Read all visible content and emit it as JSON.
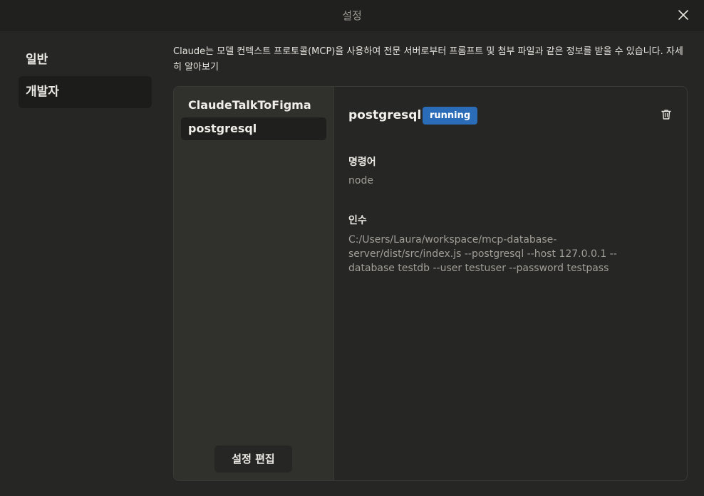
{
  "window": {
    "title": "설정"
  },
  "nav": {
    "items": [
      {
        "label": "일반"
      },
      {
        "label": "개발자"
      }
    ]
  },
  "developer": {
    "description": "Claude는 모델 컨텍스트 프로토콜(MCP)을 사용하여 전문 서버로부터 프롬프트 및 첨부 파일과 같은 정보를 받을 수 있습니다.",
    "learn_more": "자세히 알아보기",
    "servers": [
      {
        "name": "ClaudeTalkToFigma"
      },
      {
        "name": "postgresql"
      }
    ],
    "edit_config_label": "설정 편집",
    "selected": {
      "name": "postgresql",
      "status": "running",
      "command_label": "명령어",
      "command_value": "node",
      "args_label": "인수",
      "args_value": "C:/Users/Laura/workspace/mcp-database-server/dist/src/index.js --postgresql --host 127.0.0.1 --database testdb --user testuser --password testpass"
    }
  },
  "colors": {
    "status_running": "#2b6cb8"
  },
  "icons": {
    "close": "close-icon",
    "delete": "trash-icon"
  }
}
